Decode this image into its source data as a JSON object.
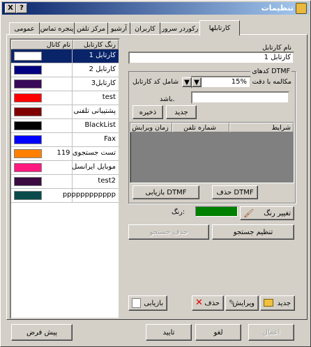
{
  "window": {
    "title": "تنظیمات",
    "help": "?",
    "close": "X"
  },
  "tabs": [
    {
      "label": "کارتابلها"
    },
    {
      "label": "رکوردر سرور"
    },
    {
      "label": "کاربران"
    },
    {
      "label": "آرشیو"
    },
    {
      "label": "مرکز تلفن"
    },
    {
      "label": "پنجره تماس"
    },
    {
      "label": "عمومی"
    }
  ],
  "list": {
    "col_name": "نام کانال",
    "col_color": "رنگ کارتابل",
    "rows": [
      {
        "name": "کارتابل 1",
        "color": "#ffffff"
      },
      {
        "name": "کارتابل 2",
        "color": "#000080"
      },
      {
        "name": "کارتابل3",
        "color": "#3a0a5a"
      },
      {
        "name": "test",
        "color": "#ff0000"
      },
      {
        "name": "پشتیبانی تلفنی",
        "color": "#800000"
      },
      {
        "name": "BlackList",
        "color": "#000000"
      },
      {
        "name": "Fax",
        "color": "#0000ff"
      },
      {
        "name": "تست جستجوی 119",
        "color": "#ff8000"
      },
      {
        "name": "موبایل ایرانسل",
        "color": "#ff1a80"
      },
      {
        "name": "test2",
        "color": "#3a0a40"
      },
      {
        "name": "pppppppppppp",
        "color": "#0a4a4a"
      }
    ]
  },
  "form": {
    "name_label": "نام کارتابل",
    "name_value": "کارتابل 1",
    "dtmf_group": "کدهای DTMF",
    "accuracy_label": "مکالمه با دقت",
    "accuracy_value": "15%",
    "includes_label": "شامل کد کارتابل",
    "baashad_label": "باشد.",
    "new_btn": "جدید",
    "save_btn": "ذخیره",
    "table_cols": [
      "شرایط",
      "شماره تلفن",
      "زمان ویرایش"
    ],
    "delete_dtmf": "حذف DTMF",
    "restore_dtmf": "بازیابی DTMF",
    "color_label": "رنگ:",
    "color_value": "#008000",
    "change_color": "تغییر رنگ",
    "search_setup": "تنظیم جستجو",
    "search_delete": "حذف جستجو",
    "restore": "بازیابی",
    "del": "حذف",
    "edit": "ویرایش",
    "add": "جدید"
  },
  "footer": {
    "defaults": "پیش فرض",
    "ok": "تایید",
    "cancel": "لغو",
    "apply": "اعمال"
  }
}
